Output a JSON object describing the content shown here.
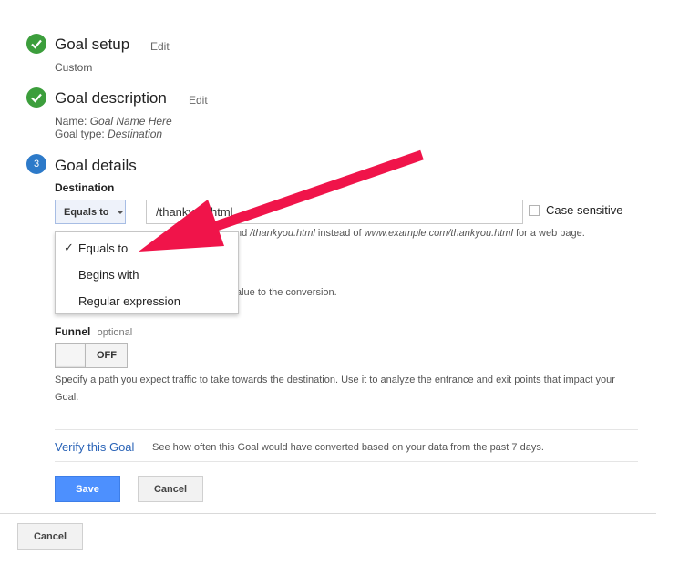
{
  "steps": {
    "setup": {
      "title": "Goal setup",
      "edit": "Edit",
      "value": "Custom"
    },
    "description": {
      "title": "Goal description",
      "edit": "Edit",
      "name_label": "Name:",
      "name_value": "Goal Name Here",
      "type_label": "Goal type:",
      "type_value": "Destination"
    },
    "details": {
      "number": "3",
      "title": "Goal details"
    }
  },
  "destination": {
    "label": "Destination",
    "match_type": "Equals to",
    "input_value": "/thankyou.html",
    "case_sensitive_label": "Case sensitive",
    "help_prefix": "nd ",
    "help_example1": "/thankyou.html",
    "help_mid": " instead of ",
    "help_example2": "www.example.com/thankyou.html",
    "help_suffix": " for a web page.",
    "value_help": "alue to the conversion."
  },
  "match_menu": {
    "items": [
      "Equals to",
      "Begins with",
      "Regular expression"
    ],
    "selected": "Equals to"
  },
  "funnel": {
    "label": "Funnel",
    "optional": "optional",
    "toggle_state": "OFF",
    "help": "Specify a path you expect traffic to take towards the destination. Use it to analyze the entrance and exit points that impact your Goal."
  },
  "verify": {
    "link": "Verify this Goal",
    "text": "See how often this Goal would have converted based on your data from the past 7 days."
  },
  "buttons": {
    "save": "Save",
    "cancel": "Cancel",
    "outer_cancel": "Cancel"
  },
  "colors": {
    "accent_blue": "#4d90fe",
    "step_done": "#3c9e3c",
    "step_active": "#2d7ac9",
    "annotation_arrow": "#f0144a"
  }
}
